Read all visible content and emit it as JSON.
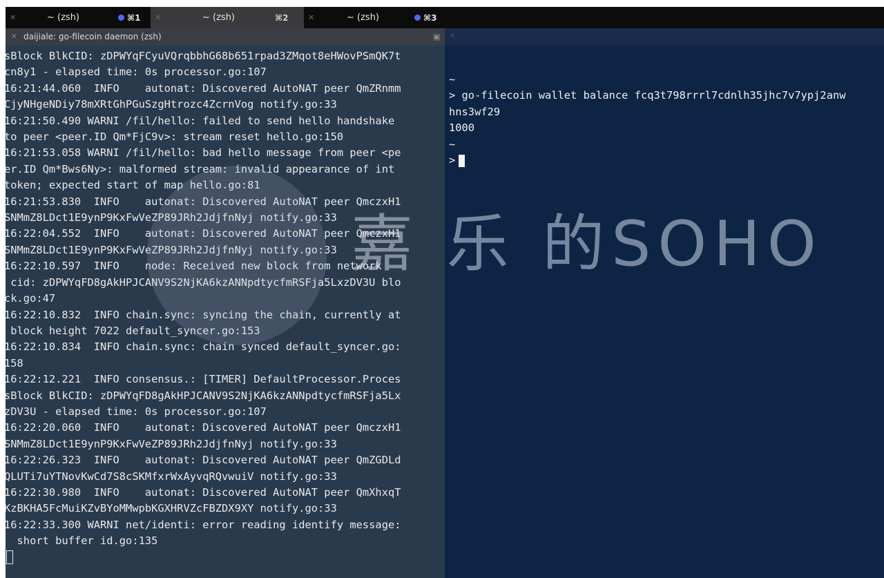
{
  "tabs": [
    {
      "title": "~ (zsh)",
      "shortcut": "⌘1",
      "icon": "close-icon"
    },
    {
      "title": "~ (zsh)",
      "shortcut": "⌘2",
      "icon": "close-icon"
    },
    {
      "title": "~ (zsh)",
      "shortcut": "⌘3",
      "icon": "close-icon"
    }
  ],
  "left_pane": {
    "header": "daijiale: go-filecoin daemon (zsh)",
    "lines": [
      "sBlock BlkCID: zDPWYqFCyuVQrqbbhG68b651rpad3ZMqot8eHWovPSmQK7t",
      "cn8y1 - elapsed time: 0s processor.go:107",
      "16:21:44.060  INFO    autonat: Discovered AutoNAT peer QmZRnmm",
      "CjyNHgeNDiy78mXRtGhPGuSzgHtrozc4ZcrnVog notify.go:33",
      "16:21:50.490 WARNI /fil/hello: failed to send hello handshake",
      "to peer <peer.ID Qm*FjC9v>: stream reset hello.go:150",
      "16:21:53.058 WARNI /fil/hello: bad hello message from peer <pe",
      "er.ID Qm*Bws6Ny>: malformed stream: invalid appearance of int",
      "token; expected start of map hello.go:81",
      "16:21:53.830  INFO    autonat: Discovered AutoNAT peer QmczxH1",
      "SNMmZ8LDct1E9ynP9KxFwVeZP89JRh2JdjfnNyj notify.go:33",
      "16:22:04.552  INFO    autonat: Discovered AutoNAT peer QmczxH1",
      "SNMmZ8LDct1E9ynP9KxFwVeZP89JRh2JdjfnNyj notify.go:33",
      "16:22:10.597  INFO    node: Received new block from network",
      " cid: zDPWYqFD8gAkHPJCANV9S2NjKA6kzANNpdtycfmRSFja5LxzDV3U blo",
      "ck.go:47",
      "16:22:10.832  INFO chain.sync: syncing the chain, currently at",
      " block height 7022 default_syncer.go:153",
      "16:22:10.834  INFO chain.sync: chain synced default_syncer.go:",
      "158",
      "16:22:12.221  INFO consensus.: [TIMER] DefaultProcessor.Proces",
      "sBlock BlkCID: zDPWYqFD8gAkHPJCANV9S2NjKA6kzANNpdtycfmRSFja5Lx",
      "zDV3U - elapsed time: 0s processor.go:107",
      "16:22:20.060  INFO    autonat: Discovered AutoNAT peer QmczxH1",
      "SNMmZ8LDct1E9ynP9KxFwVeZP89JRh2JdjfnNyj notify.go:33",
      "16:22:26.323  INFO    autonat: Discovered AutoNAT peer QmZGDLd",
      "QLUTi7uYTNovKwCd7S8cSKMfxrWxAyvqRQvwuiV notify.go:33",
      "16:22:30.980  INFO    autonat: Discovered AutoNAT peer QmXhxqT",
      "KzBKHA5FcMuiKZvBYoMMwpbKGXHRVZcFBZDX9XY notify.go:33",
      "16:22:33.300 WARNI net/identi: error reading identify message:",
      "  short buffer id.go:135"
    ]
  },
  "right_pane": {
    "lines": [
      "~",
      "> go-filecoin wallet balance fcq3t798rrrl7cdnlh35jhc7v7ypj2anw",
      "hns3wf29",
      "1000",
      "",
      "~"
    ],
    "prompt": ">"
  },
  "watermark": "嘉 乐 的SOHO"
}
